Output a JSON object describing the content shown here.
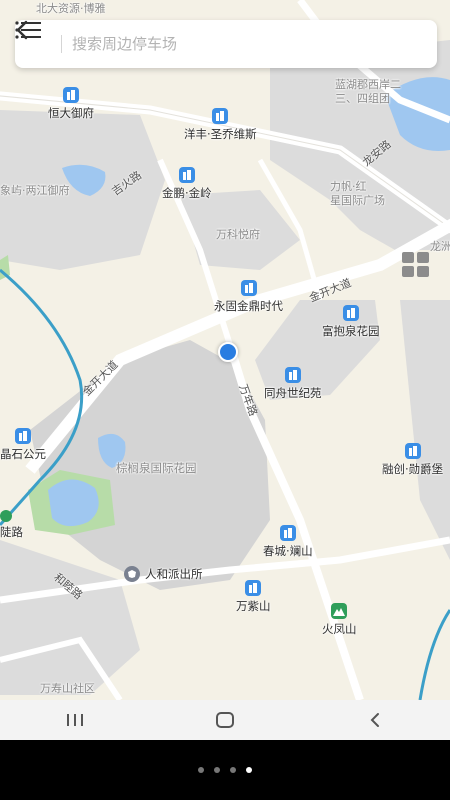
{
  "search": {
    "placeholder": "搜索周边停车场"
  },
  "map": {
    "top_partial": "北大资源·博雅",
    "areas": [
      {
        "id": "lanhu",
        "text": "蓝湖郡西岸二\n三、四组团"
      },
      {
        "id": "lifan",
        "text": "力帆·红\n星国际广场"
      },
      {
        "id": "wanke",
        "text": "万科悦府"
      },
      {
        "id": "wanshou",
        "text": "万寿山社区"
      },
      {
        "id": "xiangyu",
        "text": "象屿·两江御府"
      },
      {
        "id": "long",
        "text": "龙洲"
      }
    ],
    "pois": [
      {
        "id": "hengda",
        "text": "恒大御府",
        "kind": "building"
      },
      {
        "id": "yangfeng",
        "text": "洋丰·圣乔维斯",
        "kind": "building"
      },
      {
        "id": "jinpeng",
        "text": "金鹏·金岭",
        "kind": "building"
      },
      {
        "id": "yonggu",
        "text": "永固金鼎时代",
        "kind": "building"
      },
      {
        "id": "fubao",
        "text": "富抱泉花园",
        "kind": "building"
      },
      {
        "id": "tongzhou",
        "text": "同舟世纪苑",
        "kind": "building"
      },
      {
        "id": "jingshi",
        "text": "晶石公元",
        "kind": "building"
      },
      {
        "id": "rongchuang",
        "text": "融创·勋爵堡",
        "kind": "building"
      },
      {
        "id": "chuncheng",
        "text": "春城·斓山",
        "kind": "building"
      },
      {
        "id": "wanzi",
        "text": "万紫山",
        "kind": "building"
      },
      {
        "id": "huofeng",
        "text": "火凤山",
        "kind": "mountain"
      },
      {
        "id": "renhe",
        "text": "人和派出所",
        "kind": "police"
      },
      {
        "id": "zongquan",
        "text": "棕榈泉国际花园",
        "kind": "building"
      },
      {
        "id": "station",
        "text": "陡路",
        "kind": "station"
      }
    ],
    "roads": [
      {
        "id": "longan",
        "text": "龙安路"
      },
      {
        "id": "jikai1",
        "text": "金开大道"
      },
      {
        "id": "jikai2",
        "text": "金开大道"
      },
      {
        "id": "jihuo",
        "text": "吉火路"
      },
      {
        "id": "wannian",
        "text": "万年路"
      },
      {
        "id": "heling",
        "text": "和睦路"
      }
    ]
  },
  "pager": {
    "count": 4,
    "active": 3
  }
}
